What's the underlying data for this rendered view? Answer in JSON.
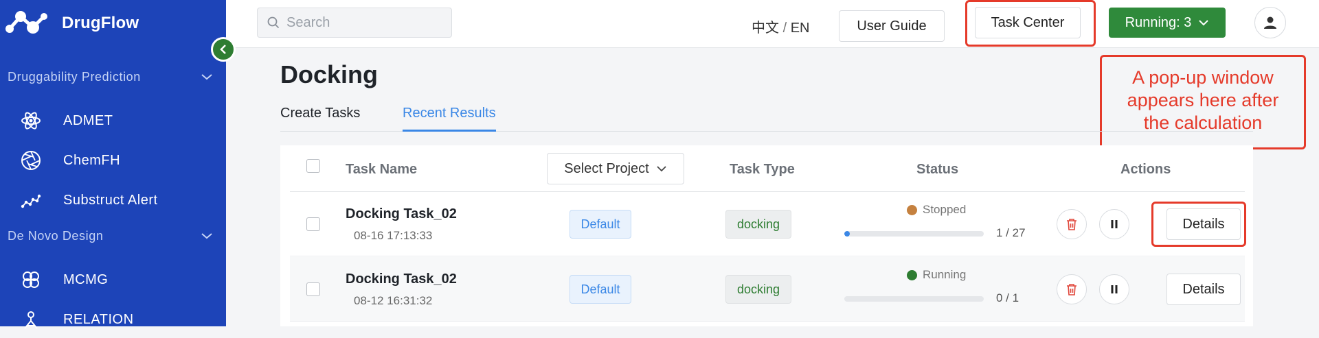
{
  "app": {
    "name": "DrugFlow"
  },
  "sidebar": {
    "sections": [
      {
        "title": "Druggability Prediction",
        "items": [
          {
            "label": "ADMET",
            "icon": "atom-icon"
          },
          {
            "label": "ChemFH",
            "icon": "aperture-icon"
          },
          {
            "label": "Substruct Alert",
            "icon": "molecule-icon"
          }
        ]
      },
      {
        "title": "De Novo Design",
        "items": [
          {
            "label": "MCMG",
            "icon": "hexagon-cluster-icon"
          },
          {
            "label": "RELATION",
            "icon": "relation-icon"
          }
        ]
      }
    ]
  },
  "header": {
    "search_placeholder": "Search",
    "lang_zh": "中文",
    "lang_sep": "/",
    "lang_en": "EN",
    "user_guide": "User Guide",
    "task_center": "Task Center",
    "running": "Running: 3"
  },
  "annotation": {
    "line1": "A pop-up window",
    "line2": "appears here after",
    "line3": "the calculation"
  },
  "main": {
    "title": "Docking",
    "tabs": [
      {
        "label": "Create Tasks",
        "active": false
      },
      {
        "label": "Recent Results",
        "active": true
      }
    ],
    "table": {
      "headers": {
        "task_name": "Task Name",
        "select_project": "Select Project",
        "task_type": "Task Type",
        "status": "Status",
        "actions": "Actions"
      },
      "rows": [
        {
          "name": "Docking Task_02",
          "date": "08-16 17:13:33",
          "project": "Default",
          "type": "docking",
          "status": "Stopped",
          "status_color": "#c5813f",
          "progress_fraction": 0.037,
          "count": "1 / 27",
          "details": "Details"
        },
        {
          "name": "Docking Task_02",
          "date": "08-12 16:31:32",
          "project": "Default",
          "type": "docking",
          "status": "Running",
          "status_color": "#2e7d32",
          "progress_fraction": 0,
          "count": "0 / 1",
          "details": "Details"
        }
      ]
    }
  },
  "colors": {
    "sidebar_bg": "#1d44b8",
    "accent_blue": "#3a87e6",
    "running_green": "#2f8a3b",
    "annotation_red": "#e53a2a"
  }
}
